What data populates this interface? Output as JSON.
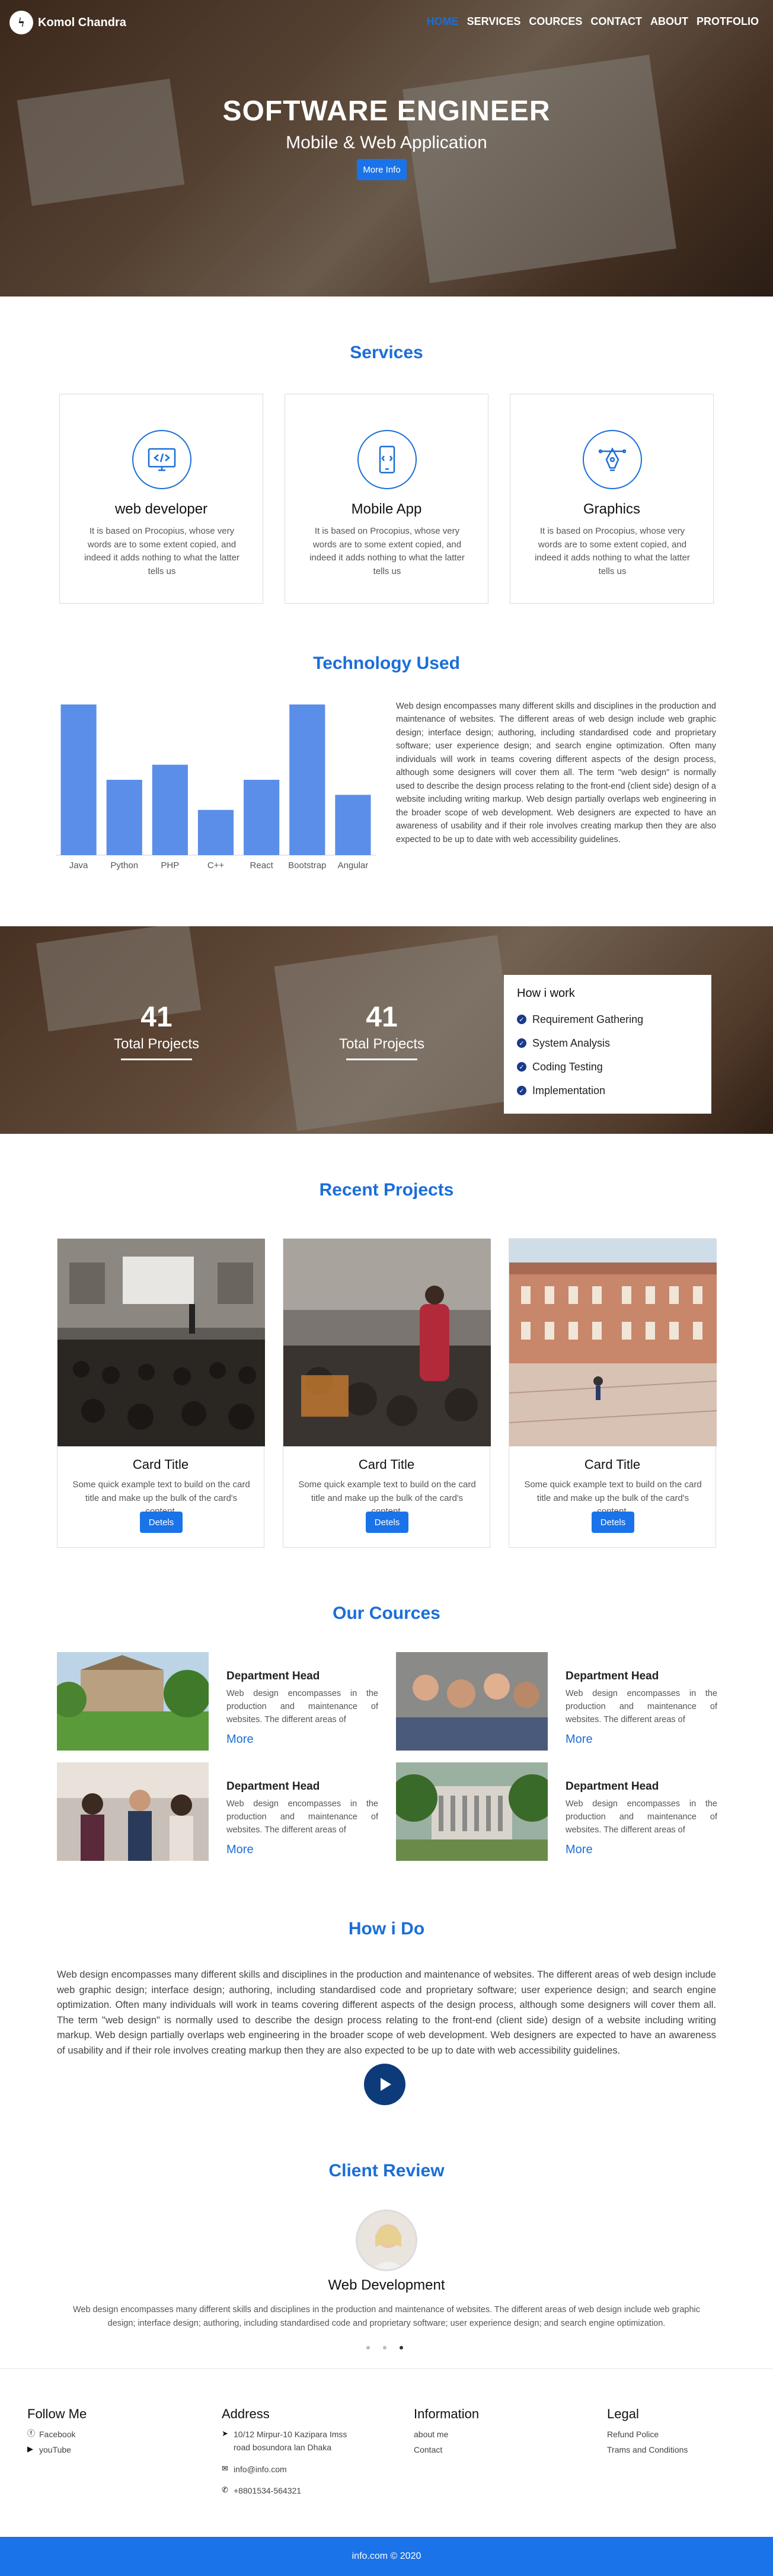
{
  "nav": {
    "logo_letter": "ϟ",
    "brand": "Komol Chandra",
    "items": [
      {
        "label": "HOME",
        "active": true
      },
      {
        "label": "SERVICES"
      },
      {
        "label": "COURCES"
      },
      {
        "label": "CONTACT"
      },
      {
        "label": "ABOUT"
      },
      {
        "label": "PROTFOLIO"
      }
    ]
  },
  "hero": {
    "title": "SOFTWARE ENGINEER",
    "subtitle": "Mobile & Web Application",
    "button": "More Info"
  },
  "services": {
    "title": "Services",
    "items": [
      {
        "icon": "code-monitor-icon",
        "title": "web developer",
        "text": "It is based on Procopius, whose very words are to some extent copied, and indeed it adds nothing to what the latter tells us"
      },
      {
        "icon": "mobile-phone-icon",
        "title": "Mobile App",
        "text": "It is based on Procopius, whose very words are to some extent copied, and indeed it adds nothing to what the latter tells us"
      },
      {
        "icon": "pen-tool-icon",
        "title": "Graphics",
        "text": "It is based on Procopius, whose very words are to some extent copied, and indeed it adds nothing to what the latter tells us"
      }
    ]
  },
  "technology": {
    "title": "Technology Used",
    "text": "Web design encompasses many different skills and disciplines in the production and maintenance of websites. The different areas of web design include web graphic design; interface design; authoring, including standardised code and proprietary software; user experience design; and search engine optimization. Often many individuals will work in teams covering different aspects of the design process, although some designers will cover them all. The term \"web design\" is normally used to describe the design process relating to the front-end (client side) design of a website including writing markup. Web design partially overlaps web engineering in the broader scope of web development. Web designers are expected to have an awareness of usability and if their role involves creating markup then they are also expected to be up to date with web accessibility guidelines."
  },
  "chart_data": {
    "type": "bar",
    "categories": [
      "Java",
      "Python",
      "PHP",
      "C++",
      "React",
      "Bootstrap",
      "Angular"
    ],
    "values": [
      100,
      50,
      60,
      30,
      50,
      100,
      40
    ],
    "ylim": [
      0,
      100
    ],
    "color": "#5a8ee8",
    "grid": false
  },
  "stats": {
    "items": [
      {
        "number": "41",
        "label": "Total Projects"
      },
      {
        "number": "41",
        "label": "Total Projects"
      }
    ],
    "how": {
      "title": "How i work",
      "items": [
        "Requirement Gathering",
        "System Analysis",
        "Coding Testing",
        "Implementation"
      ]
    }
  },
  "projects": {
    "title": "Recent Projects",
    "cards": [
      {
        "title": "Card Title",
        "text": "Some quick example text to build on the card title and make up the bulk of the card's content.",
        "button": "Detels"
      },
      {
        "title": "Card Title",
        "text": "Some quick example text to build on the card title and make up the bulk of the card's content.",
        "button": "Detels"
      },
      {
        "title": "Card Title",
        "text": "Some quick example text to build on the card title and make up the bulk of the card's content.",
        "button": "Detels"
      }
    ]
  },
  "courses": {
    "title": "Our Cources",
    "items": [
      {
        "title": "Department Head",
        "text": "Web design encompasses in the production and maintenance of websites. The different areas of",
        "link": "More"
      },
      {
        "title": "Department Head",
        "text": "Web design encompasses in the production and maintenance of websites. The different areas of",
        "link": "More"
      },
      {
        "title": "Department Head",
        "text": "Web design encompasses in the production and maintenance of websites. The different areas of",
        "link": "More"
      },
      {
        "title": "Department Head",
        "text": "Web design encompasses in the production and maintenance of websites. The different areas of",
        "link": "More"
      }
    ]
  },
  "howido": {
    "title": "How i Do",
    "text": "Web design encompasses many different skills and disciplines in the production and maintenance of websites. The different areas of web design include web graphic design; interface design; authoring, including standardised code and proprietary software; user experience design; and search engine optimization. Often many individuals will work in teams covering different aspects of the design process, although some designers will cover them all. The term \"web design\" is normally used to describe the design process relating to the front-end (client side) design of a website including writing markup. Web design partially overlaps web engineering in the broader scope of web development. Web designers are expected to have an awareness of usability and if their role involves creating markup then they are also expected to be up to date with web accessibility guidelines."
  },
  "review": {
    "title": "Client Review",
    "name": "Web Development",
    "text": "Web design encompasses many different skills and disciplines in the production and maintenance of websites. The different areas of web design include web graphic design; interface design; authoring, including standardised code and proprietary software; user experience design; and search engine optimization."
  },
  "footer": {
    "follow": {
      "title": "Follow Me",
      "items": [
        "Facebook",
        "youTube"
      ]
    },
    "address": {
      "title": "Address",
      "street": "10/12 Mirpur-10 Kazipara Imss road bosundora lan Dhaka",
      "email": "info@info.com",
      "phone": "+8801534-564321"
    },
    "info": {
      "title": "Information",
      "items": [
        "about me",
        "Contact"
      ]
    },
    "legal": {
      "title": "Legal",
      "items": [
        "Refund Police",
        "Trams and Conditions"
      ]
    },
    "copyright": "info.com © 2020"
  }
}
